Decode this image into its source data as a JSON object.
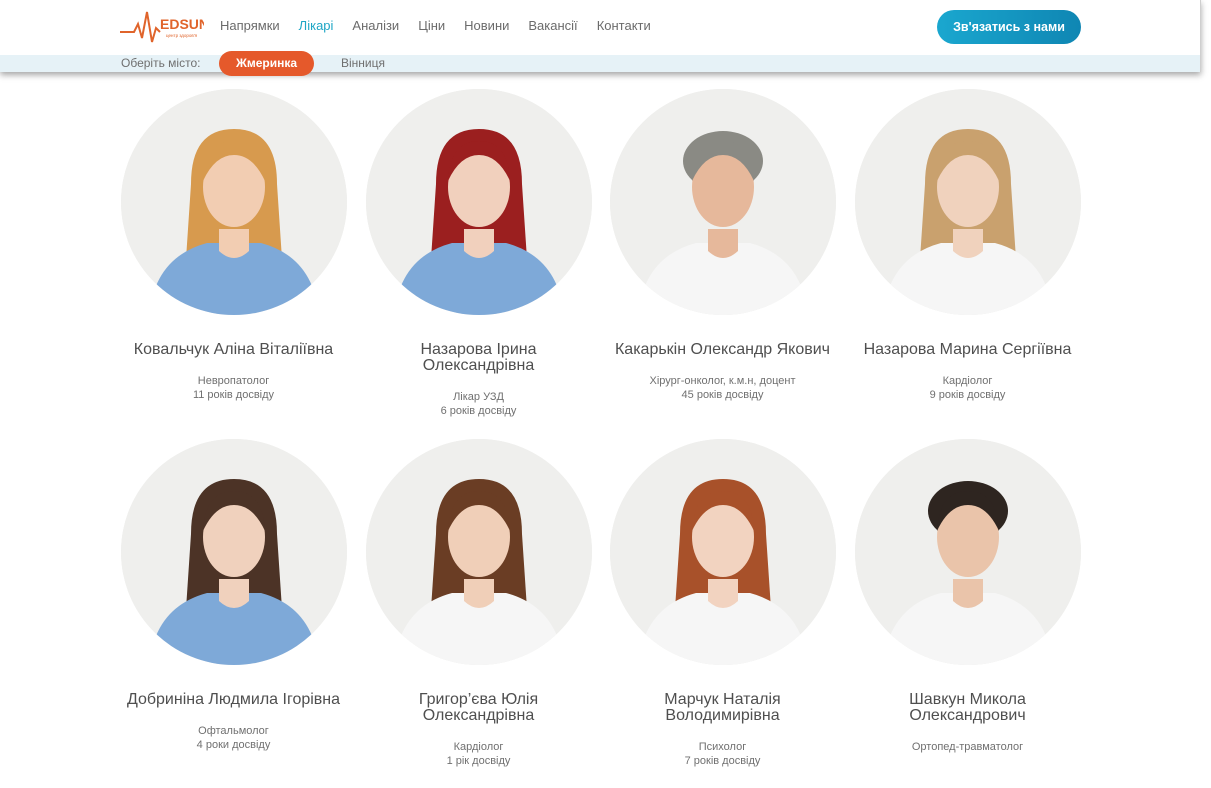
{
  "brand": {
    "name": "EDSUN",
    "tagline": "центр здоров'я"
  },
  "nav": [
    "Напрямки",
    "Лікарі",
    "Аналізи",
    "Ціни",
    "Новини",
    "Вакансії",
    "Контакти"
  ],
  "nav_active": "Лікарі",
  "contact_button": "Зв'язатись з нами",
  "city": {
    "label": "Оберіть місто:",
    "selected": "Жмеринка",
    "other": "Вінниця"
  },
  "colors": {
    "accent": "#1aa7cf",
    "city_pill": "#e5592b",
    "brand_orange": "#e0642b"
  },
  "doctors": [
    {
      "name": "Ковальчук Аліна Віталіївна",
      "specialty": "Невропатолог",
      "experience": "11 років досвіду"
    },
    {
      "name": "Назарова Ірина Олександрівна",
      "specialty": "Лікар УЗД",
      "experience": "6 років досвіду"
    },
    {
      "name": "Какарькін Олександр Якович",
      "specialty": "Хірург-онколог, к.м.н, доцент",
      "experience": "45 років досвіду"
    },
    {
      "name": "Назарова Марина Сергіївна",
      "specialty": "Кардіолог",
      "experience": "9 років досвіду"
    },
    {
      "name": "Добриніна Людмила Ігорівна",
      "specialty": "Офтальмолог",
      "experience": "4 роки досвіду"
    },
    {
      "name": "Григор’єва Юлія Олександрівна",
      "specialty": "Кардіолог",
      "experience": "1 рік досвіду"
    },
    {
      "name": "Марчук Наталія Володимирівна",
      "specialty": "Психолог",
      "experience": "7 років досвіду"
    },
    {
      "name": "Шавкун Микола Олександрович",
      "specialty": "Ортопед-травматолог",
      "experience": ""
    }
  ]
}
